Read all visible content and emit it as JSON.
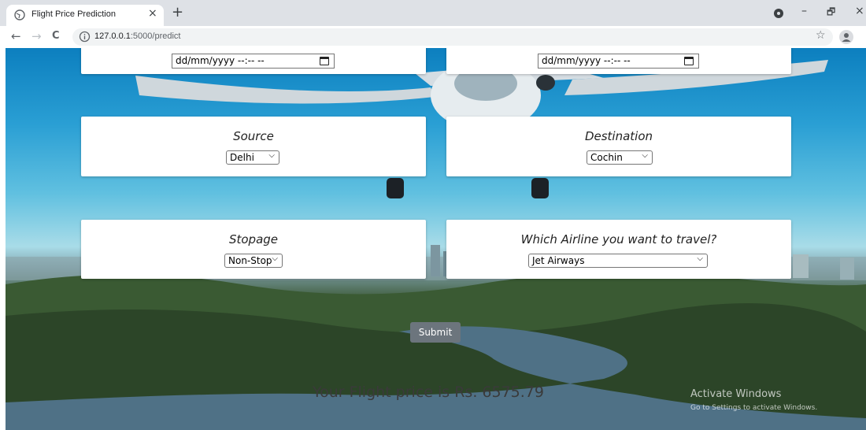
{
  "browser": {
    "tab_title": "Flight Price Prediction",
    "close_glyph": "×",
    "newtab_glyph": "+",
    "url_host": "127.0.0.1",
    "url_path": ":5000/predict",
    "back_glyph": "←",
    "forward_glyph": "→",
    "reload_glyph": "C",
    "star_glyph": "☆",
    "menu_glyph": "⋮",
    "minimize_glyph": "–",
    "maximize_glyph": "🗗",
    "window_close_glyph": "×"
  },
  "form": {
    "departure_datetime_placeholder": "dd/mm/yyyy --:-- --",
    "arrival_datetime_placeholder": "dd/mm/yyyy --:-- --",
    "source_label": "Source",
    "source_value": "Delhi",
    "destination_label": "Destination",
    "destination_value": "Cochin",
    "stopage_label": "Stopage",
    "stopage_value": "Non-Stop",
    "airline_label": "Which Airline you want to travel?",
    "airline_value": "Jet Airways",
    "submit_label": "Submit"
  },
  "result": {
    "text": "Your Flight price is Rs. 6575.79"
  },
  "watermark": {
    "title": "Activate Windows",
    "subtitle": "Go to Settings to activate Windows."
  },
  "icons": [
    "globe-icon",
    "info-icon",
    "star-icon",
    "avatar-icon",
    "calendar-icon",
    "chevron-down-icon"
  ],
  "colors": {
    "submit_bg": "#6c757d",
    "tabbar_bg": "#dee1e6"
  }
}
